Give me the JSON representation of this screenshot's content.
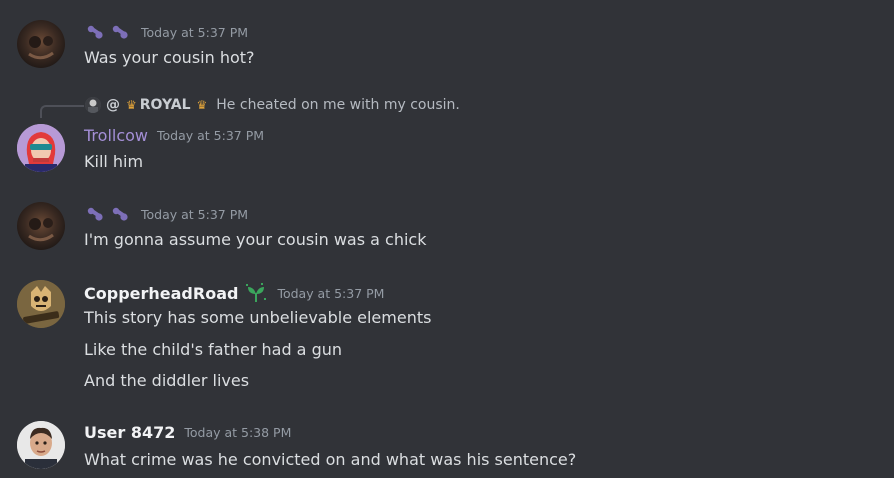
{
  "messages": [
    {
      "username": "",
      "timestamp": "Today at 5:37 PM",
      "lines": [
        "Was your cousin hot?"
      ]
    },
    {
      "reply": {
        "at": "@",
        "name": "ROYAL",
        "preview": "He cheated on me with my cousin."
      },
      "username": "Trollcow",
      "timestamp": "Today at 5:37 PM",
      "lines": [
        "Kill him"
      ]
    },
    {
      "username": "",
      "timestamp": "Today at 5:37 PM",
      "lines": [
        "I'm gonna assume your cousin was a chick"
      ]
    },
    {
      "username": "CopperheadRoad",
      "timestamp": "Today at 5:37 PM",
      "lines": [
        "This story has some unbelievable elements",
        "Like the child's father had a gun",
        "And the diddler lives"
      ]
    },
    {
      "username": "User 8472",
      "timestamp": "Today at 5:38 PM",
      "lines": [
        "What crime  was he convicted on and what was his sentence?"
      ]
    }
  ],
  "icons": {
    "deco_name": "paw-glyphs-icon",
    "reply_crown": "crown-icon",
    "sprout": "sprout-icon"
  },
  "colors": {
    "background": "#313338",
    "text": "#dbdee1",
    "timestamp": "#949ba4",
    "trollcow_name": "#a48fd6",
    "sprout": "#3ba55c"
  }
}
